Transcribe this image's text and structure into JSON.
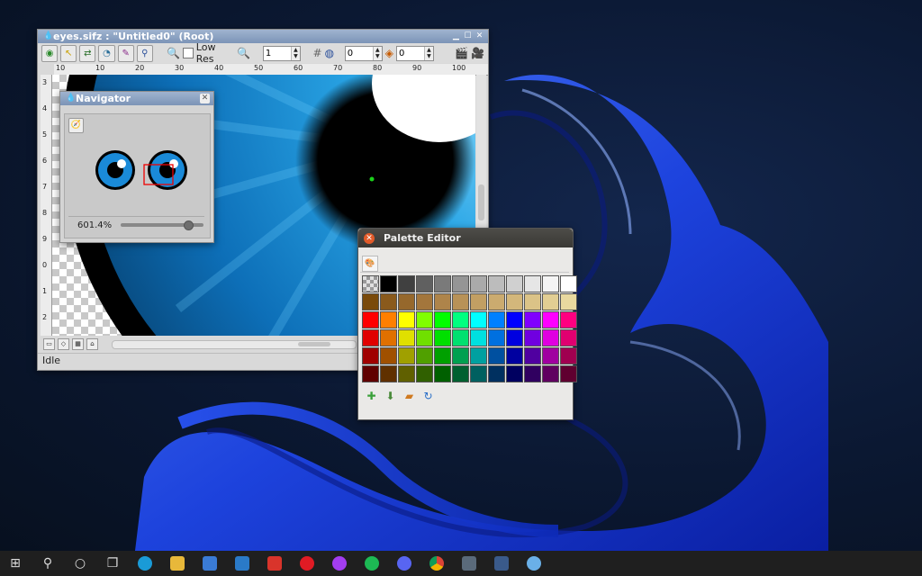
{
  "main_window": {
    "title": "eyes.sifz : \"Untitled0\" (Root)",
    "low_res_label": "Low Res",
    "frame_value": "1",
    "spin_a_value": "0",
    "spin_b_value": "0",
    "status": "Idle",
    "ruler_h": [
      "10",
      "10",
      "20",
      "30",
      "40",
      "50",
      "60",
      "70",
      "80",
      "90",
      "100",
      "110"
    ],
    "ruler_v": [
      "3",
      "4",
      "5",
      "6",
      "7",
      "8",
      "9",
      "0",
      "1",
      "2"
    ]
  },
  "navigator": {
    "title": "Navigator",
    "zoom_label": "601.4%",
    "zoom_fraction": 0.8
  },
  "palette_editor": {
    "title": "Palette Editor",
    "swatches": [
      [
        "#d8d8d8",
        "#000000",
        "#404040",
        "#606060",
        "#7a7a7a",
        "#959595",
        "#aaaaaa",
        "#bcbcbc",
        "#d0d0d0",
        "#e6e6e6",
        "#f4f4f4",
        "#ffffff"
      ],
      [
        "#7a4a0a",
        "#8a5a1c",
        "#96682c",
        "#a3763c",
        "#ae844a",
        "#b89257",
        "#c29f63",
        "#cbab6f",
        "#d3b77b",
        "#dbc387",
        "#e2ce93",
        "#e9d99f"
      ],
      [
        "#ff0000",
        "#ff7f00",
        "#ffff00",
        "#80ff00",
        "#00ff00",
        "#00ff80",
        "#00ffff",
        "#0080ff",
        "#0000ff",
        "#8000ff",
        "#ff00ff",
        "#ff0080"
      ],
      [
        "#e00000",
        "#e07000",
        "#e0e000",
        "#70e000",
        "#00e000",
        "#00e070",
        "#00e0e0",
        "#0070e0",
        "#0000e0",
        "#7000e0",
        "#e000e0",
        "#e00070"
      ],
      [
        "#a00000",
        "#a05000",
        "#a0a000",
        "#50a000",
        "#00a000",
        "#00a050",
        "#00a0a0",
        "#0050a0",
        "#0000a0",
        "#5000a0",
        "#a000a0",
        "#a00050"
      ],
      [
        "#600000",
        "#603000",
        "#606000",
        "#306000",
        "#006000",
        "#006030",
        "#006060",
        "#003060",
        "#000060",
        "#300060",
        "#600060",
        "#600030"
      ]
    ]
  },
  "taskbar": {
    "icons": [
      "windows-start-icon",
      "search-icon",
      "cortana-icon",
      "task-view-icon",
      "edge-icon",
      "file-explorer-icon",
      "store-icon",
      "mail-icon",
      "wps-office-icon",
      "opera-icon",
      "messenger-icon",
      "spotify-icon",
      "discord-icon",
      "chrome-icon",
      "calculator-icon",
      "synfig-icon",
      "paint-icon"
    ]
  },
  "colors": {
    "accent_blue": "#1a8ad8",
    "taskbar_bg": "#1f1f1f"
  }
}
